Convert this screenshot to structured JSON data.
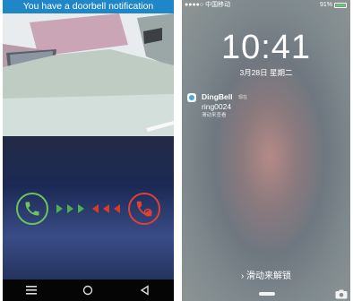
{
  "android": {
    "notification_text": "You have a doorbell notification",
    "answer_icon": "phone-answer-icon",
    "decline_icon": "phone-decline-icon",
    "accent_green": "#6ec45c",
    "accent_red": "#e24034",
    "nav": {
      "menu_icon": "menu-icon",
      "home_icon": "home-circle-icon",
      "back_icon": "back-triangle-icon"
    }
  },
  "ios": {
    "status": {
      "carrier": "●●●●○ 中国移动",
      "battery": "91%"
    },
    "time": "10:41",
    "date": "3月28日 星期二",
    "notification": {
      "app_name": "DingBell",
      "time_label": "现在",
      "message": "ring0024",
      "action_hint": "滑动来查看"
    },
    "slide_to_unlock": "› 滑动来解锁",
    "camera_icon": "camera-icon"
  }
}
